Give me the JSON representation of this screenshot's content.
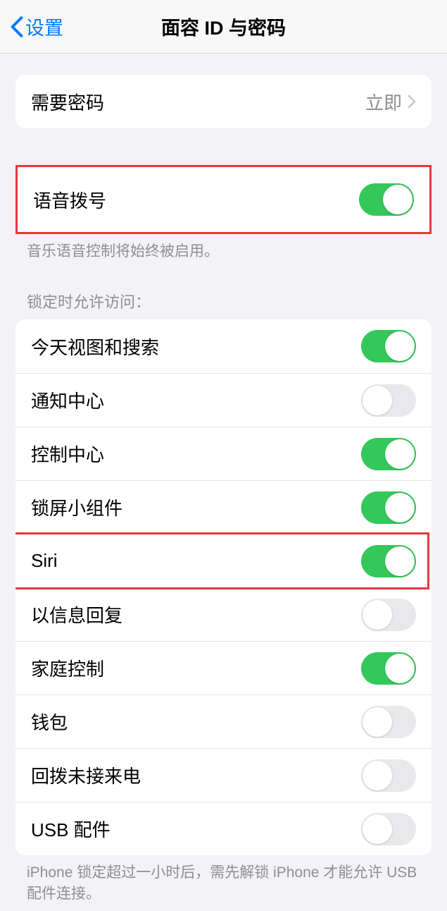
{
  "nav": {
    "back_label": "设置",
    "title": "面容 ID 与密码"
  },
  "require_passcode": {
    "label": "需要密码",
    "value": "立即"
  },
  "voice_dial": {
    "label": "语音拨号",
    "footer": "音乐语音控制将始终被启用。",
    "toggle": true
  },
  "lock_access": {
    "header": "锁定时允许访问：",
    "items": [
      {
        "label": "今天视图和搜索",
        "toggle": true
      },
      {
        "label": "通知中心",
        "toggle": false
      },
      {
        "label": "控制中心",
        "toggle": true
      },
      {
        "label": "锁屏小组件",
        "toggle": true
      },
      {
        "label": "Siri",
        "toggle": true
      },
      {
        "label": "以信息回复",
        "toggle": false
      },
      {
        "label": "家庭控制",
        "toggle": true
      },
      {
        "label": "钱包",
        "toggle": false
      },
      {
        "label": "回拨未接来电",
        "toggle": false
      },
      {
        "label": "USB 配件",
        "toggle": false
      }
    ],
    "footer": "iPhone 锁定超过一小时后，需先解锁 iPhone 才能允许 USB 配件连接。"
  },
  "highlighted_rows": [
    "语音拨号",
    "Siri"
  ]
}
